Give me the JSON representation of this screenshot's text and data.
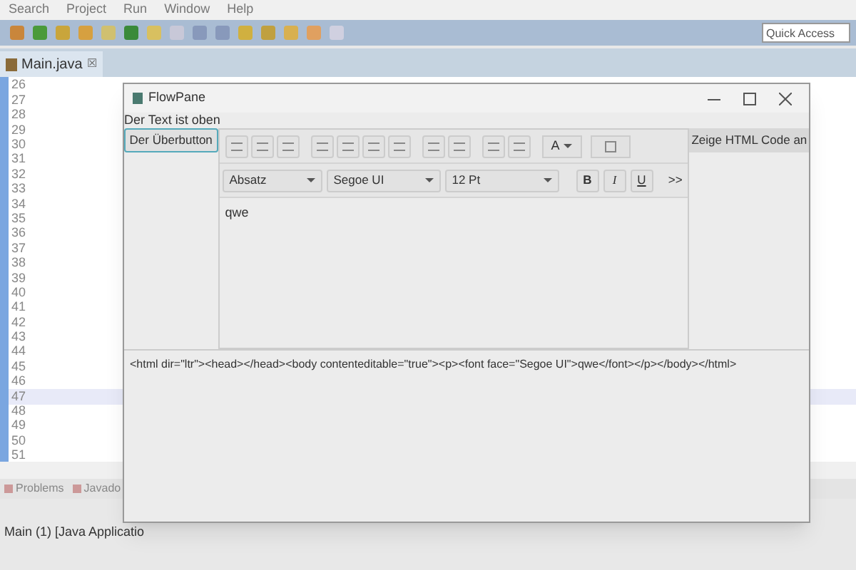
{
  "menu": [
    "Search",
    "Project",
    "Run",
    "Window",
    "Help"
  ],
  "quick_access": {
    "placeholder": "Quick Access"
  },
  "editor_tab": {
    "label": "Main.java",
    "close": "☒"
  },
  "code_lines": [
    {
      "number": "26",
      "current": false
    },
    {
      "number": "27",
      "current": false
    },
    {
      "number": "28",
      "current": false
    },
    {
      "number": "29",
      "current": false
    },
    {
      "number": "30",
      "current": false
    },
    {
      "number": "31",
      "current": false
    },
    {
      "number": "32",
      "current": false
    },
    {
      "number": "33",
      "current": false
    },
    {
      "number": "34",
      "current": false
    },
    {
      "number": "35",
      "current": false
    },
    {
      "number": "36",
      "current": false
    },
    {
      "number": "37",
      "current": false
    },
    {
      "number": "38",
      "current": false
    },
    {
      "number": "39",
      "current": false
    },
    {
      "number": "40",
      "current": false
    },
    {
      "number": "41",
      "current": false
    },
    {
      "number": "42",
      "current": false
    },
    {
      "number": "43",
      "current": false
    },
    {
      "number": "44",
      "current": false
    },
    {
      "number": "45",
      "current": false
    },
    {
      "number": "46",
      "current": false
    },
    {
      "number": "47",
      "current": true
    },
    {
      "number": "48",
      "current": false
    },
    {
      "number": "49",
      "current": false
    },
    {
      "number": "50",
      "current": false
    },
    {
      "number": "51",
      "current": false
    }
  ],
  "bottom_tabs": [
    "Problems",
    "Javado"
  ],
  "console_status": "Main (1) [Java Applicatio",
  "window": {
    "title": "FlowPane",
    "label": "Der Text ist oben",
    "button": "Der Überbutton",
    "side_button": "Zeige HTML Code an",
    "text_color": "A",
    "format": "Absatz",
    "font": "Segoe UI",
    "size": "12 Pt",
    "bold": "B",
    "italic": "I",
    "underline": "U",
    "more": ">>",
    "content": "qwe",
    "html": "<html dir=\"ltr\"><head></head><body contenteditable=\"true\"><p><font face=\"Segoe UI\">qwe</font></p></body></html>"
  }
}
